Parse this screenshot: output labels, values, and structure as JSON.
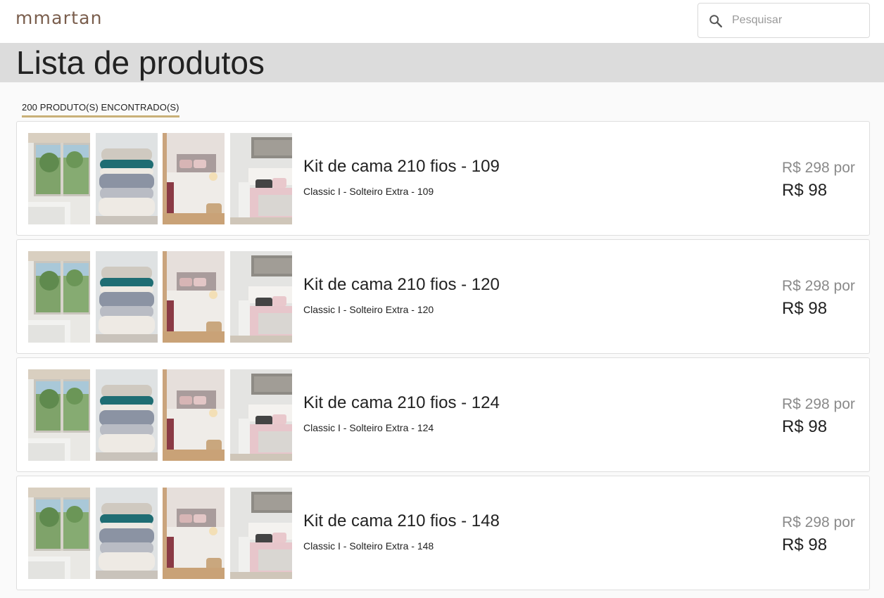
{
  "header": {
    "logo": "mmartan",
    "search": {
      "placeholder": "Pesquisar",
      "value": ""
    }
  },
  "page": {
    "title": "Lista de produtos",
    "result_count": "200 PRODUTO(S) ENCONTRADO(S)"
  },
  "products": [
    {
      "name": "Kit de cama 210 fios - 109",
      "subtitle": "Classic I - Solteiro Extra - 109",
      "old_price": "R$ 298 por",
      "price": "R$ 98"
    },
    {
      "name": "Kit de cama 210 fios - 120",
      "subtitle": "Classic I - Solteiro Extra - 120",
      "old_price": "R$ 298 por",
      "price": "R$ 98"
    },
    {
      "name": "Kit de cama 210 fios - 124",
      "subtitle": "Classic I - Solteiro Extra - 124",
      "old_price": "R$ 298 por",
      "price": "R$ 98"
    },
    {
      "name": "Kit de cama 210 fios - 148",
      "subtitle": "Classic I - Solteiro Extra - 148",
      "old_price": "R$ 298 por",
      "price": "R$ 98"
    }
  ],
  "colors": {
    "brand": "#7a5e4d",
    "count_underline": "#c9b078",
    "title_band": "#dcdcdc",
    "old_price": "#8a8a8a"
  },
  "icons": {
    "search": "search-icon"
  }
}
